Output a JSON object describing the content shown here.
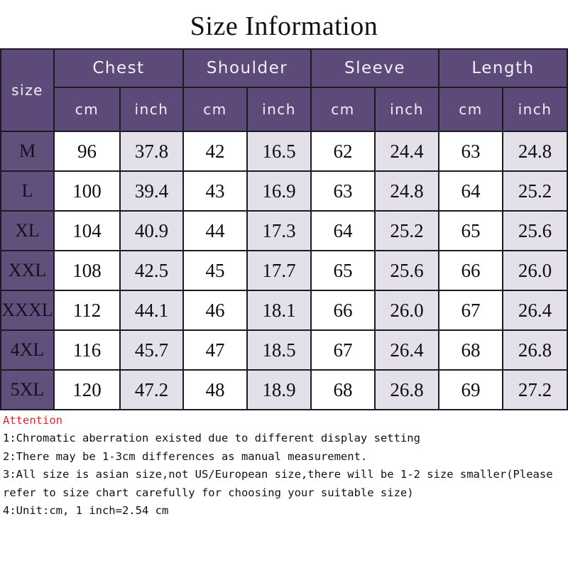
{
  "title": "Size Information",
  "table": {
    "size_header": "size",
    "groups": [
      {
        "label": "Chest"
      },
      {
        "label": "Shoulder"
      },
      {
        "label": "Sleeve"
      },
      {
        "label": "Length"
      }
    ],
    "units": [
      "cm",
      "inch",
      "cm",
      "inch",
      "cm",
      "inch",
      "cm",
      "inch"
    ],
    "rows": [
      {
        "size": "M",
        "values": [
          "96",
          "37.8",
          "42",
          "16.5",
          "62",
          "24.4",
          "63",
          "24.8"
        ]
      },
      {
        "size": "L",
        "values": [
          "100",
          "39.4",
          "43",
          "16.9",
          "63",
          "24.8",
          "64",
          "25.2"
        ]
      },
      {
        "size": "XL",
        "values": [
          "104",
          "40.9",
          "44",
          "17.3",
          "64",
          "25.2",
          "65",
          "25.6"
        ]
      },
      {
        "size": "XXL",
        "values": [
          "108",
          "42.5",
          "45",
          "17.7",
          "65",
          "25.6",
          "66",
          "26.0"
        ]
      },
      {
        "size": "XXXL",
        "values": [
          "112",
          "44.1",
          "46",
          "18.1",
          "66",
          "26.0",
          "67",
          "26.4"
        ]
      },
      {
        "size": "4XL",
        "values": [
          "116",
          "45.7",
          "47",
          "18.5",
          "67",
          "26.4",
          "68",
          "26.8"
        ]
      },
      {
        "size": "5XL",
        "values": [
          "120",
          "47.2",
          "48",
          "18.9",
          "68",
          "26.8",
          "69",
          "27.2"
        ]
      }
    ]
  },
  "notes": {
    "heading": "Attention",
    "lines": [
      "1:Chromatic aberration existed due to different display setting",
      "2:There may be 1-3cm differences as manual measurement.",
      "3:All size is asian size,not US/European size,there will be 1-2 size smaller(Please refer to size chart carefully for choosing your suitable size)",
      "4:Unit:cm, 1 inch=2.54 cm"
    ]
  },
  "colors": {
    "header_purple": "#5d4a78",
    "size_cell_purple": "#61507c",
    "inch_cell_lavender": "#e4e0ea",
    "cm_cell_white": "#ffffff",
    "border": "#1b1b24",
    "attention_red": "#e3262c",
    "page_background": "#ffffff"
  }
}
